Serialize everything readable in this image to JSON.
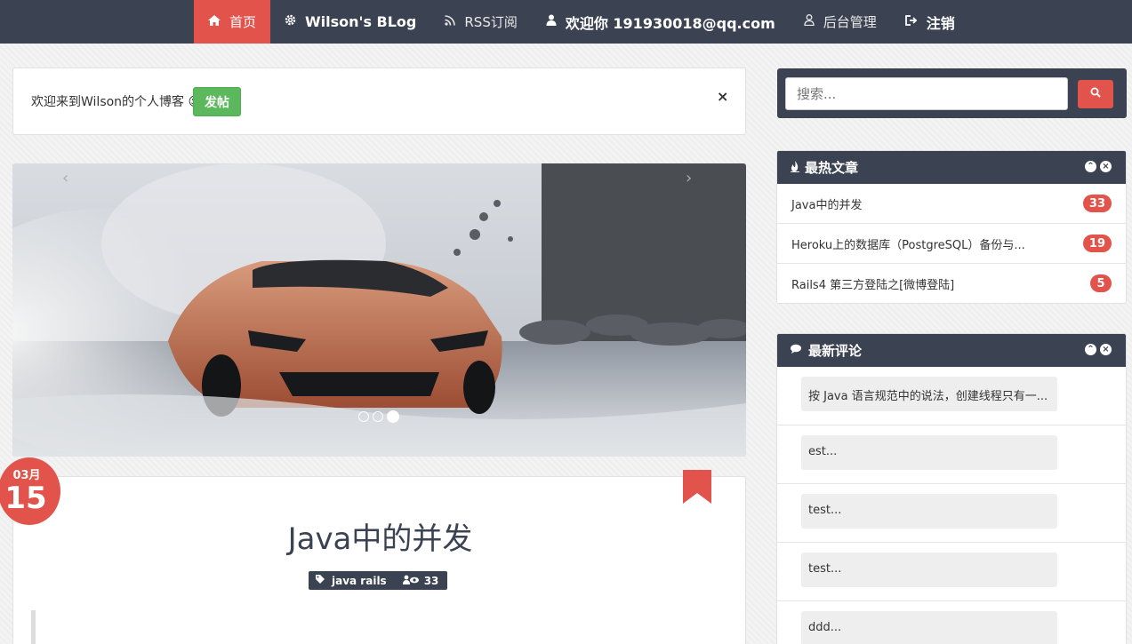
{
  "nav": {
    "items": [
      {
        "label": "首页",
        "icon": "home-icon",
        "active": true
      },
      {
        "label": "Wilson's BLog",
        "icon": "gear-icon"
      },
      {
        "label": "RSS订阅",
        "icon": "rss-icon"
      },
      {
        "label": "欢迎你 191930018@qq.com",
        "icon": "user-icon"
      },
      {
        "label": "后台管理",
        "icon": "user-admin-icon"
      },
      {
        "label": "注销",
        "icon": "sign-out-icon"
      }
    ]
  },
  "alert": {
    "message": "欢迎来到Wilson的个人博客 ☺",
    "post_button": "发帖",
    "close": "×"
  },
  "carousel": {
    "prev": "‹",
    "next": "›",
    "slides": 3,
    "active_slide": 3
  },
  "post": {
    "date_month": "03月",
    "date_day": "15",
    "title": "Java中的并发",
    "tags": "java rails",
    "views": "33"
  },
  "search": {
    "placeholder": "搜索..."
  },
  "hot_posts": {
    "title": "最热文章",
    "items": [
      {
        "title": "Java中的并发",
        "count": "33"
      },
      {
        "title": "Heroku上的数据库（PostgreSQL）备份与...",
        "count": "19"
      },
      {
        "title": "Rails4 第三方登陆之[微博登陆]",
        "count": "5"
      }
    ]
  },
  "latest_comments": {
    "title": "最新评论",
    "items": [
      {
        "text": "按 Java 语言规范中的说法，创建线程只有一..."
      },
      {
        "text": "est..."
      },
      {
        "text": "test..."
      },
      {
        "text": "test..."
      },
      {
        "text": "ddd..."
      }
    ]
  },
  "colors": {
    "navbar": "#3b4251",
    "accent": "#e2534c",
    "success": "#5cb85c"
  }
}
